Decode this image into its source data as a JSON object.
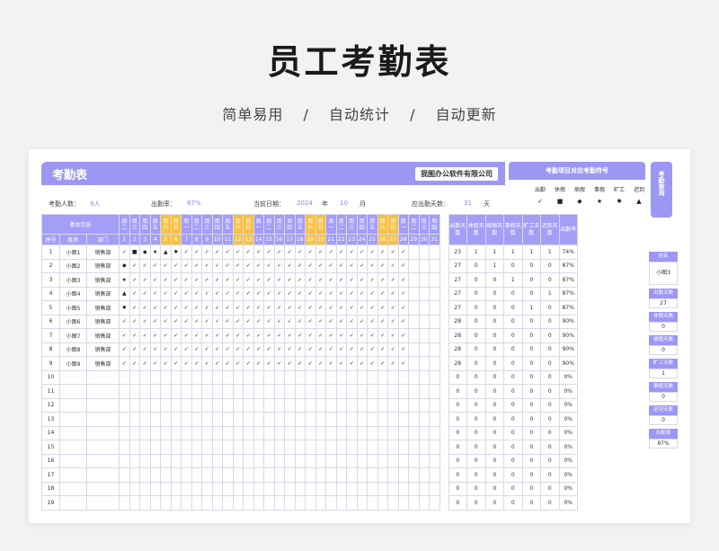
{
  "hero": {
    "title": "员工考勤表",
    "sub1": "简单易用",
    "sep": "/",
    "sub2": "自动统计",
    "sub3": "自动更新"
  },
  "banner": {
    "title": "考勤表",
    "company": "我图办公软件有限公司"
  },
  "info": {
    "headcount_label": "考勤人数：",
    "headcount_value": "9人",
    "rate_label": "出勤率：",
    "rate_value": "87%",
    "date_label": "当前日期：",
    "year_value": "2024",
    "year_unit": "年",
    "month_value": "10",
    "month_unit": "月",
    "due_label": "应出勤天数：",
    "due_value": "31",
    "due_unit": "天"
  },
  "legend": {
    "title": "考勤项目对应考勤符号",
    "items": [
      {
        "label": "出勤",
        "symbol": "✓"
      },
      {
        "label": "休假",
        "symbol": "■"
      },
      {
        "label": "病假",
        "symbol": "◆"
      },
      {
        "label": "事假",
        "symbol": "★"
      },
      {
        "label": "旷工",
        "symbol": "✸"
      },
      {
        "label": "迟到",
        "symbol": "▲"
      }
    ]
  },
  "side_tab": "考勤查询",
  "side_panel": [
    {
      "label": "姓名",
      "value": "小图3"
    },
    {
      "label": "出勤天数",
      "value": "27"
    },
    {
      "label": "休假天数",
      "value": "0"
    },
    {
      "label": "病假天数",
      "value": "0"
    },
    {
      "label": "旷工天数",
      "value": "1"
    },
    {
      "label": "事假天数",
      "value": "0"
    },
    {
      "label": "迟到天数",
      "value": "0"
    },
    {
      "label": "出勤率",
      "value": "87%"
    }
  ],
  "table": {
    "basic_info": "基本信息",
    "col_seq": "序号",
    "col_name": "姓名",
    "col_dept": "部门",
    "weekdays": [
      "周二",
      "周三",
      "周四",
      "周五",
      "周六",
      "周日",
      "周一",
      "周二",
      "周三",
      "周四",
      "周五",
      "周六",
      "周日",
      "周一",
      "周二",
      "周三",
      "周四",
      "周五",
      "周六",
      "周日",
      "周一",
      "周二",
      "周三",
      "周四",
      "周五",
      "周六",
      "周日",
      "周一",
      "周二",
      "周三",
      "周四"
    ],
    "days": [
      "1",
      "2",
      "3",
      "4",
      "5",
      "6",
      "7",
      "8",
      "9",
      "10",
      "11",
      "12",
      "13",
      "14",
      "15",
      "16",
      "17",
      "18",
      "19",
      "20",
      "21",
      "22",
      "23",
      "24",
      "25",
      "26",
      "27",
      "28",
      "29",
      "30",
      "31"
    ],
    "weekend_idx": [
      4,
      5,
      11,
      12,
      18,
      19,
      25,
      26
    ],
    "stat_headers": [
      "出勤天数",
      "休假天数",
      "病假天数",
      "事假天数",
      "旷工天数",
      "迟到天数",
      "出勤率"
    ],
    "rows": [
      {
        "seq": "1",
        "name": "小图1",
        "dept": "销售部",
        "marks": [
          "✓",
          "■",
          "◆",
          "★",
          "▲",
          "✸",
          "✓",
          "✓",
          "✓",
          "✓",
          "✓",
          "✓",
          "✓",
          "✓",
          "✓",
          "✓",
          "✓",
          "✓",
          "✓",
          "✓",
          "✓",
          "✓",
          "✓",
          "✓",
          "✓",
          "✓",
          "✓",
          "✓",
          "",
          "",
          ""
        ],
        "stats": [
          "23",
          "1",
          "1",
          "1",
          "1",
          "1",
          "74%"
        ]
      },
      {
        "seq": "2",
        "name": "小图2",
        "dept": "销售部",
        "marks": [
          "◆",
          "✓",
          "✓",
          "✓",
          "✓",
          "✓",
          "✓",
          "✓",
          "✓",
          "✓",
          "✓",
          "✓",
          "✓",
          "✓",
          "✓",
          "✓",
          "✓",
          "✓",
          "✓",
          "✓",
          "✓",
          "✓",
          "✓",
          "✓",
          "✓",
          "✓",
          "✓",
          "✓",
          "",
          "",
          ""
        ],
        "stats": [
          "27",
          "0",
          "1",
          "0",
          "0",
          "0",
          "87%"
        ]
      },
      {
        "seq": "3",
        "name": "小图3",
        "dept": "销售部",
        "marks": [
          "★",
          "✓",
          "✓",
          "✓",
          "✓",
          "✓",
          "✓",
          "✓",
          "✓",
          "✓",
          "✓",
          "✓",
          "✓",
          "✓",
          "✓",
          "✓",
          "✓",
          "✓",
          "✓",
          "✓",
          "✓",
          "✓",
          "✓",
          "✓",
          "✓",
          "✓",
          "✓",
          "✓",
          "",
          "",
          ""
        ],
        "stats": [
          "27",
          "0",
          "0",
          "1",
          "0",
          "0",
          "87%"
        ]
      },
      {
        "seq": "4",
        "name": "小图4",
        "dept": "销售部",
        "marks": [
          "▲",
          "✓",
          "✓",
          "✓",
          "✓",
          "✓",
          "✓",
          "✓",
          "✓",
          "✓",
          "✓",
          "✓",
          "✓",
          "✓",
          "✓",
          "✓",
          "✓",
          "✓",
          "✓",
          "✓",
          "✓",
          "✓",
          "✓",
          "✓",
          "✓",
          "✓",
          "✓",
          "✓",
          "",
          "",
          ""
        ],
        "stats": [
          "27",
          "0",
          "0",
          "0",
          "0",
          "1",
          "87%"
        ]
      },
      {
        "seq": "5",
        "name": "小图5",
        "dept": "销售部",
        "marks": [
          "✸",
          "✓",
          "✓",
          "✓",
          "✓",
          "✓",
          "✓",
          "✓",
          "✓",
          "✓",
          "✓",
          "✓",
          "✓",
          "✓",
          "✓",
          "✓",
          "✓",
          "✓",
          "✓",
          "✓",
          "✓",
          "✓",
          "✓",
          "✓",
          "✓",
          "✓",
          "✓",
          "✓",
          "",
          "",
          ""
        ],
        "stats": [
          "27",
          "0",
          "0",
          "0",
          "1",
          "0",
          "87%"
        ]
      },
      {
        "seq": "6",
        "name": "小图6",
        "dept": "销售部",
        "marks": [
          "✓",
          "✓",
          "✓",
          "✓",
          "✓",
          "✓",
          "✓",
          "✓",
          "✓",
          "✓",
          "✓",
          "✓",
          "✓",
          "✓",
          "✓",
          "✓",
          "✓",
          "✓",
          "✓",
          "✓",
          "✓",
          "✓",
          "✓",
          "✓",
          "✓",
          "✓",
          "✓",
          "✓",
          "",
          "",
          ""
        ],
        "stats": [
          "28",
          "0",
          "0",
          "0",
          "0",
          "0",
          "90%"
        ]
      },
      {
        "seq": "7",
        "name": "小图7",
        "dept": "销售部",
        "marks": [
          "✓",
          "✓",
          "✓",
          "✓",
          "✓",
          "✓",
          "✓",
          "✓",
          "✓",
          "✓",
          "✓",
          "✓",
          "✓",
          "✓",
          "✓",
          "✓",
          "✓",
          "✓",
          "✓",
          "✓",
          "✓",
          "✓",
          "✓",
          "✓",
          "✓",
          "✓",
          "✓",
          "✓",
          "",
          "",
          ""
        ],
        "stats": [
          "28",
          "0",
          "0",
          "0",
          "0",
          "0",
          "90%"
        ]
      },
      {
        "seq": "8",
        "name": "小图8",
        "dept": "销售部",
        "marks": [
          "✓",
          "✓",
          "✓",
          "✓",
          "✓",
          "✓",
          "✓",
          "✓",
          "✓",
          "✓",
          "✓",
          "✓",
          "✓",
          "✓",
          "✓",
          "✓",
          "✓",
          "✓",
          "✓",
          "✓",
          "✓",
          "✓",
          "✓",
          "✓",
          "✓",
          "✓",
          "✓",
          "✓",
          "",
          "",
          ""
        ],
        "stats": [
          "28",
          "0",
          "0",
          "0",
          "0",
          "0",
          "90%"
        ]
      },
      {
        "seq": "9",
        "name": "小图9",
        "dept": "销售部",
        "marks": [
          "✓",
          "✓",
          "✓",
          "✓",
          "✓",
          "✓",
          "✓",
          "✓",
          "✓",
          "✓",
          "✓",
          "✓",
          "✓",
          "✓",
          "✓",
          "✓",
          "✓",
          "✓",
          "✓",
          "✓",
          "✓",
          "✓",
          "✓",
          "✓",
          "✓",
          "✓",
          "✓",
          "✓",
          "",
          "",
          ""
        ],
        "stats": [
          "28",
          "0",
          "0",
          "0",
          "0",
          "0",
          "90%"
        ]
      },
      {
        "seq": "10",
        "name": "",
        "dept": "",
        "marks": [],
        "stats": [
          "0",
          "0",
          "0",
          "0",
          "0",
          "0",
          "0%"
        ]
      },
      {
        "seq": "11",
        "name": "",
        "dept": "",
        "marks": [],
        "stats": [
          "0",
          "0",
          "0",
          "0",
          "0",
          "0",
          "0%"
        ]
      },
      {
        "seq": "12",
        "name": "",
        "dept": "",
        "marks": [],
        "stats": [
          "0",
          "0",
          "0",
          "0",
          "0",
          "0",
          "0%"
        ]
      },
      {
        "seq": "13",
        "name": "",
        "dept": "",
        "marks": [],
        "stats": [
          "0",
          "0",
          "0",
          "0",
          "0",
          "0",
          "0%"
        ]
      },
      {
        "seq": "14",
        "name": "",
        "dept": "",
        "marks": [],
        "stats": [
          "0",
          "0",
          "0",
          "0",
          "0",
          "0",
          "0%"
        ]
      },
      {
        "seq": "15",
        "name": "",
        "dept": "",
        "marks": [],
        "stats": [
          "0",
          "0",
          "0",
          "0",
          "0",
          "0",
          "0%"
        ]
      },
      {
        "seq": "16",
        "name": "",
        "dept": "",
        "marks": [],
        "stats": [
          "0",
          "0",
          "0",
          "0",
          "0",
          "0",
          "0%"
        ]
      },
      {
        "seq": "17",
        "name": "",
        "dept": "",
        "marks": [],
        "stats": [
          "0",
          "0",
          "0",
          "0",
          "0",
          "0",
          "0%"
        ]
      },
      {
        "seq": "18",
        "name": "",
        "dept": "",
        "marks": [],
        "stats": [
          "0",
          "0",
          "0",
          "0",
          "0",
          "0",
          "0%"
        ]
      },
      {
        "seq": "19",
        "name": "",
        "dept": "",
        "marks": [],
        "stats": [
          "0",
          "0",
          "0",
          "0",
          "0",
          "0",
          "0%"
        ]
      }
    ]
  }
}
